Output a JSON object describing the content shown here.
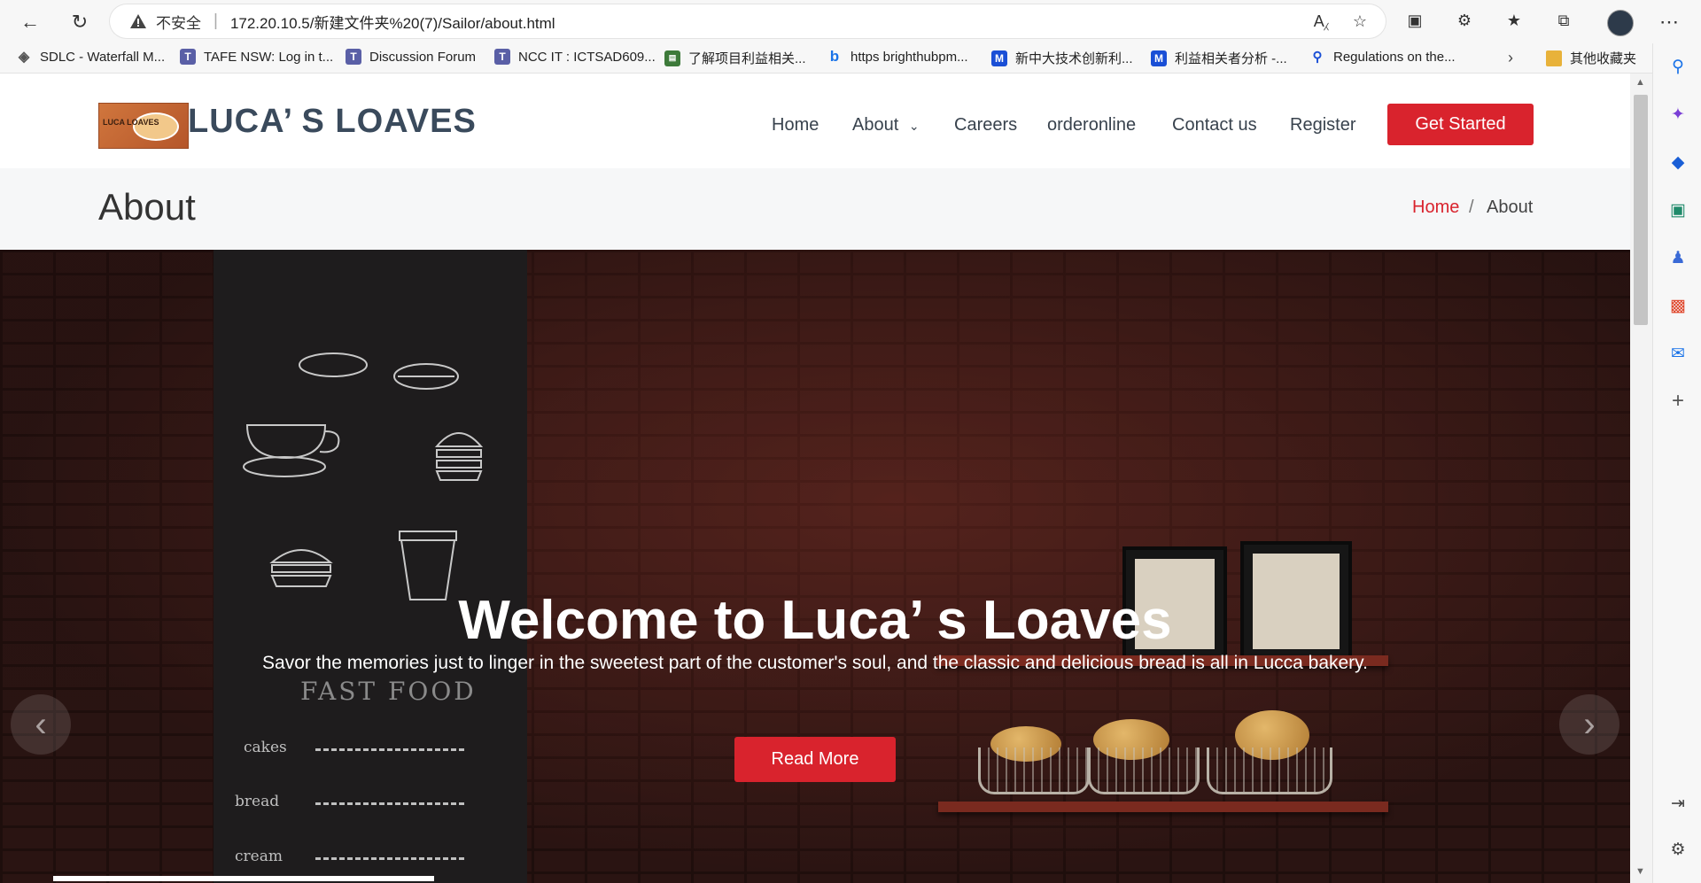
{
  "browser": {
    "insecure_label": "不安全",
    "separator": "|",
    "url": "172.20.10.5/新建文件夹%20(7)/Sailor/about.html",
    "bookmarks": [
      {
        "label": "SDLC - Waterfall M...",
        "icon": "diamond-icon",
        "color": "#555"
      },
      {
        "label": "TAFE NSW: Log in t...",
        "icon": "T",
        "color": "#5a5fa6"
      },
      {
        "label": "Discussion Forum",
        "icon": "T",
        "color": "#5a5fa6"
      },
      {
        "label": "NCC IT : ICTSAD609...",
        "icon": "T",
        "color": "#5a5fa6"
      },
      {
        "label": "了解项目利益相关...",
        "icon": "book-icon",
        "color": "#3d7a3a"
      },
      {
        "label": "https brighthubpm...",
        "icon": "bing-icon",
        "color": "#1a73e8"
      },
      {
        "label": "新中大技术创新利...",
        "icon": "M",
        "color": "#1a4fd6"
      },
      {
        "label": "利益相关者分析 -...",
        "icon": "M",
        "color": "#1a4fd6"
      },
      {
        "label": "Regulations on the...",
        "icon": "search-icon",
        "color": "#1a4fd6"
      },
      {
        "label": "其他收藏夹",
        "icon": "folder-icon",
        "color": "#e8b23a"
      }
    ]
  },
  "site": {
    "logo_text": "LUCA’ S LOAVES",
    "logo_img_text": "LUCA LOAVES",
    "nav": [
      {
        "label": "Home"
      },
      {
        "label": "About"
      },
      {
        "label": "Careers"
      },
      {
        "label": "orderonline"
      },
      {
        "label": "Contact us"
      },
      {
        "label": "Register"
      }
    ],
    "cta_label": "Get Started",
    "accent": "#d9232d"
  },
  "title_bar": {
    "page_title": "About",
    "breadcrumb_home": "Home",
    "breadcrumb_sep": "/",
    "breadcrumb_current": "About"
  },
  "hero": {
    "title": "Welcome to Luca’ s Loaves",
    "subtitle": "Savor the memories just to linger in the sweetest part of the customer's soul, and the classic and delicious bread is all in Lucca bakery.",
    "button_label": "Read More",
    "chalkboard": {
      "heading": "FAST FOOD",
      "items": [
        "cakes",
        "bread",
        "cream"
      ]
    }
  }
}
